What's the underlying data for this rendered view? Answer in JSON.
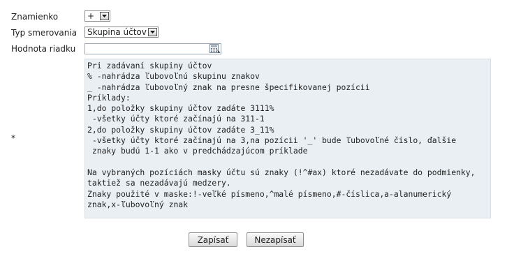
{
  "form": {
    "sign": {
      "label": "Znamienko",
      "value": "+"
    },
    "direction_type": {
      "label": "Typ smerovania",
      "value": "Skupina účtov"
    },
    "row_value": {
      "label": "Hodnota riadku",
      "value": ""
    },
    "required_mark": "*",
    "help_lines": [
      "Pri zadávaní skupiny účtov",
      "% -nahrádza ľubovoľnú skupinu znakov",
      "_ -nahrádza ľubovoľný znak na presne špecifikovanej pozícii",
      "Príklady:",
      "1,do položky skupiny účtov zadáte 3111%",
      " -všetky účty ktoré začínajú na 311-1",
      "2,do položky skupiny účtov zadáte 3_11%",
      " -všetky účty ktoré začínajú na 3,na pozícii '_' bude ľubovoľné číslo, ďalšie",
      " znaky budú 1-1 ako v predchádzajúcom príklade",
      "",
      "Na vybraných pozíciách masky účtu sú znaky (!^#ax) ktoré nezadávate do podmienky,",
      "taktiež sa nezadávajú medzery.",
      "Znaky použité v maske:!-veľké písmeno,^malé písmeno,#-číslica,a-alanumerický",
      "znak,x-ľubovoľný znak"
    ]
  },
  "buttons": {
    "save": "Zapísať",
    "cancel": "Nezapísať"
  },
  "icons": {
    "dropdown": "chevron-down-icon",
    "picker": "calculator-icon"
  }
}
